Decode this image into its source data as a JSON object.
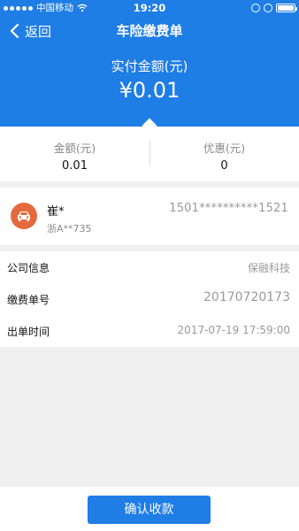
{
  "status_bar": {
    "carrier": "中国移动",
    "time": "19:20"
  },
  "nav": {
    "back_label": "返回",
    "title": "车险缴费单"
  },
  "payment": {
    "paid_label": "实付金额(元)",
    "paid_amount": "¥0.01"
  },
  "summary": {
    "amount_label": "金额(元)",
    "amount_value": "0.01",
    "discount_label": "优惠(元)",
    "discount_value": "0"
  },
  "customer": {
    "name": "崔*",
    "plate": "浙A**735",
    "phone": "1501**********1521",
    "avatar_icon": "car-icon",
    "avatar_color": "#e46a3c"
  },
  "info": {
    "rows": [
      {
        "label": "公司信息",
        "value": "保融科技"
      },
      {
        "label": "缴费单号",
        "value": "20170720173"
      },
      {
        "label": "出单时间",
        "value": "2017-07-19 17:59:00"
      }
    ]
  },
  "actions": {
    "confirm_label": "确认收款"
  },
  "colors": {
    "primary": "#1f7de6",
    "background": "#f0f0f0"
  }
}
